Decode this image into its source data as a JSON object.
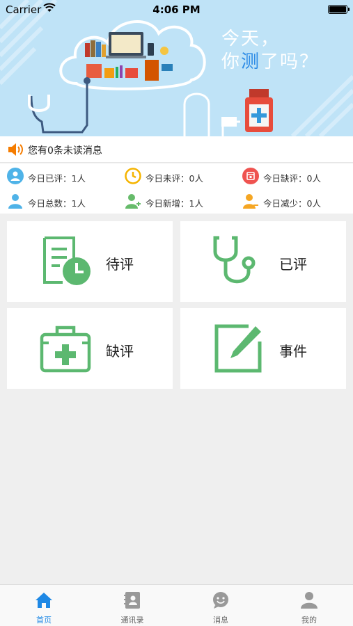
{
  "status_bar": {
    "carrier": "Carrier",
    "time": "4:06 PM"
  },
  "banner": {
    "slogan_line1": "今天，",
    "slogan_line2_prefix": "你",
    "slogan_line2_highlight": "测",
    "slogan_line2_suffix": "了吗？"
  },
  "notice": {
    "text": "您有0条未读消息"
  },
  "stats": [
    {
      "label": "今日已评：1人",
      "icon": "user-check-icon",
      "color": "#4fb3e8"
    },
    {
      "label": "今日未评：0人",
      "icon": "clock-icon",
      "color": "#f5b400"
    },
    {
      "label": "今日缺评：0人",
      "icon": "calendar-icon",
      "color": "#ef5350"
    },
    {
      "label": "今日总数：1人",
      "icon": "person-icon",
      "color": "#4fb3e8"
    },
    {
      "label": "今日新增：1人",
      "icon": "person-add-icon",
      "color": "#66bb6a"
    },
    {
      "label": "今日减少：0人",
      "icon": "person-remove-icon",
      "color": "#f5a623"
    }
  ],
  "tiles": [
    {
      "label": "待评",
      "icon": "document-clock-icon"
    },
    {
      "label": "已评",
      "icon": "stethoscope-icon"
    },
    {
      "label": "缺评",
      "icon": "medical-kit-icon"
    },
    {
      "label": "事件",
      "icon": "edit-icon"
    }
  ],
  "tile_color": "#5cb870",
  "tabs": [
    {
      "label": "首页",
      "icon": "home-icon",
      "active": true
    },
    {
      "label": "通讯录",
      "icon": "contacts-icon",
      "active": false
    },
    {
      "label": "消息",
      "icon": "chat-icon",
      "active": false
    },
    {
      "label": "我的",
      "icon": "profile-icon",
      "active": false
    }
  ],
  "colors": {
    "accent": "#1e88e5",
    "inactive": "#999999"
  }
}
